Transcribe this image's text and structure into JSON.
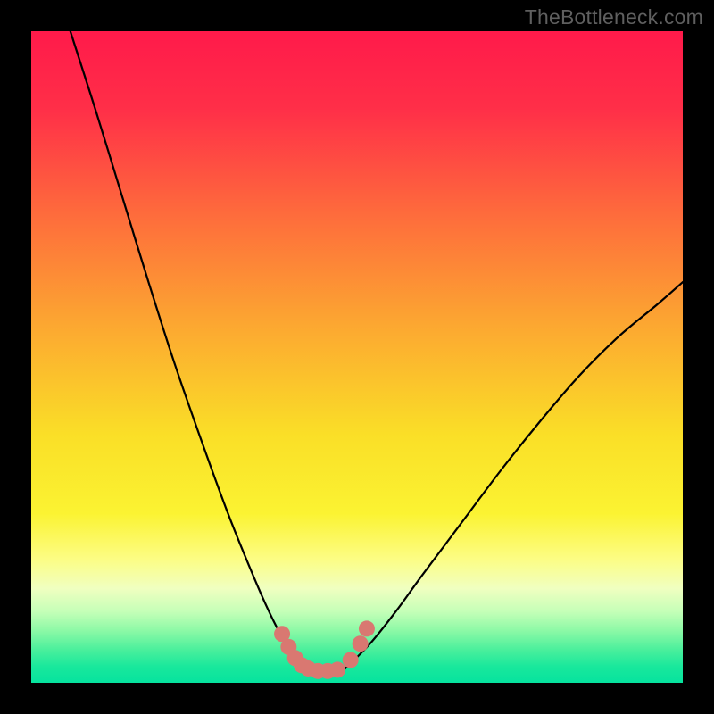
{
  "watermark": "TheBottleneck.com",
  "gradient_stops": [
    {
      "offset": 0.0,
      "color": "#ff1a4a"
    },
    {
      "offset": 0.12,
      "color": "#ff2f48"
    },
    {
      "offset": 0.28,
      "color": "#fe6b3c"
    },
    {
      "offset": 0.45,
      "color": "#fca731"
    },
    {
      "offset": 0.62,
      "color": "#fadf27"
    },
    {
      "offset": 0.74,
      "color": "#fbf332"
    },
    {
      "offset": 0.81,
      "color": "#fcfd84"
    },
    {
      "offset": 0.855,
      "color": "#f0ffc0"
    },
    {
      "offset": 0.89,
      "color": "#c6ffb8"
    },
    {
      "offset": 0.92,
      "color": "#8cf9a6"
    },
    {
      "offset": 0.95,
      "color": "#49ef9c"
    },
    {
      "offset": 0.975,
      "color": "#19e89c"
    },
    {
      "offset": 1.0,
      "color": "#06e39e"
    }
  ],
  "marker_color": "#d97871",
  "chart_data": {
    "type": "line",
    "title": "",
    "xlabel": "",
    "ylabel": "",
    "xlim": [
      0,
      1
    ],
    "ylim": [
      0,
      1
    ],
    "series": [
      {
        "name": "left-curve",
        "x": [
          0.06,
          0.1,
          0.14,
          0.18,
          0.22,
          0.26,
          0.3,
          0.33,
          0.36,
          0.385,
          0.405,
          0.42
        ],
        "y": [
          1.0,
          0.875,
          0.745,
          0.615,
          0.49,
          0.375,
          0.265,
          0.19,
          0.12,
          0.07,
          0.04,
          0.02
        ]
      },
      {
        "name": "right-curve",
        "x": [
          0.48,
          0.52,
          0.56,
          0.6,
          0.66,
          0.72,
          0.78,
          0.84,
          0.9,
          0.96,
          1.0
        ],
        "y": [
          0.02,
          0.06,
          0.11,
          0.165,
          0.245,
          0.325,
          0.4,
          0.47,
          0.53,
          0.58,
          0.615
        ]
      },
      {
        "name": "bottom-join",
        "x": [
          0.42,
          0.45,
          0.48
        ],
        "y": [
          0.02,
          0.015,
          0.02
        ]
      }
    ],
    "markers": {
      "name": "highlight-dots",
      "x": [
        0.385,
        0.395,
        0.405,
        0.415,
        0.425,
        0.44,
        0.455,
        0.47,
        0.49,
        0.505,
        0.515
      ],
      "y": [
        0.075,
        0.055,
        0.038,
        0.027,
        0.022,
        0.018,
        0.018,
        0.02,
        0.035,
        0.06,
        0.083
      ]
    }
  }
}
